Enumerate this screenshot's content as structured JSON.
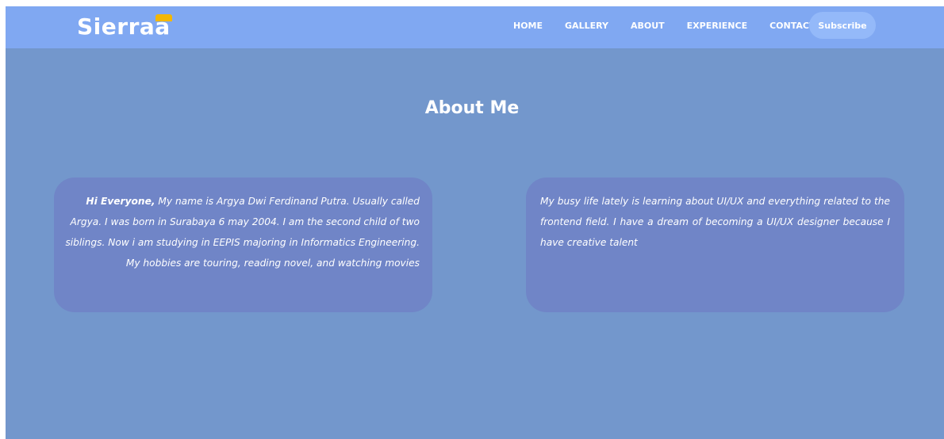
{
  "header": {
    "logo_text": "Sierraa",
    "nav_items": [
      "HOME",
      "GALLERY",
      "ABOUT",
      "EXPERIENCE",
      "CONTACT"
    ],
    "subscribe_label": "Subscribe"
  },
  "about": {
    "title": "About Me",
    "left_card": {
      "greeting": "Hi Everyone,",
      "text": " My name is Argya Dwi Ferdinand Putra. Usually called Argya. I was born in Surabaya 6 may 2004. I am the second child of two siblings. Now i am studying in EEPIS majoring in Informatics Engineering. My hobbies are touring, reading novel, and watching movies"
    },
    "right_card": {
      "text": "My busy life lately is learning about UI/UX and everything related to the frontend field. I have a dream of becoming a UI/UX designer because I have creative talent"
    }
  },
  "colors": {
    "navbar": "#80a8f2",
    "page_background": "#7397cc",
    "card_background": "#7085c7",
    "subscribe_button": "#94b9f9",
    "logo_accent": "#f2b705",
    "text": "#ffffff"
  }
}
